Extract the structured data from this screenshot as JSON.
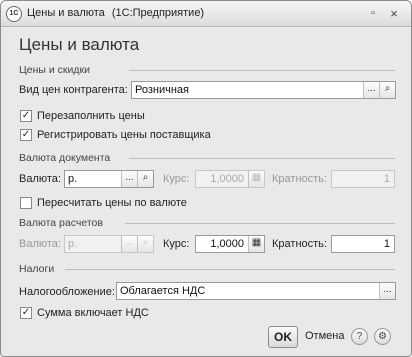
{
  "window": {
    "app_icon": "1c-logo",
    "title": "Цены и валюта",
    "app_name": "(1С:Предприятие)",
    "menu_icon": "small-menu-icon",
    "close_icon": "close-icon"
  },
  "heading": "Цены и валюта",
  "prices_group": {
    "header": "Цены и скидки",
    "price_type_label": "Вид цен контрагента:",
    "price_type_value": "Розничная",
    "refill_prices_label": "Перезаполнить цены",
    "refill_prices_checked": true,
    "register_supplier_prices_label": "Регистрировать цены поставщика",
    "register_supplier_prices_checked": true
  },
  "document_currency_group": {
    "header": "Валюта документа",
    "currency_label": "Валюта:",
    "currency_value": "р.",
    "rate_label": "Курс:",
    "rate_value": "1,0000",
    "multiplicity_label": "Кратность:",
    "multiplicity_value": "1",
    "recalc_label": "Пересчитать цены по валюте",
    "recalc_checked": false
  },
  "settlement_currency_group": {
    "header": "Валюта расчетов",
    "currency_label": "Валюта:",
    "currency_value": "р.",
    "rate_label": "Курс:",
    "rate_value": "1,0000",
    "multiplicity_label": "Кратность:",
    "multiplicity_value": "1"
  },
  "taxes_group": {
    "header": "Налоги",
    "taxation_label": "Налогообложение:",
    "taxation_value": "Облагается НДС",
    "amount_includes_vat_label": "Сумма включает НДС",
    "amount_includes_vat_checked": true
  },
  "buttons": {
    "ok": "OK",
    "cancel": "Отмена",
    "help_glyph": "?",
    "settings_glyph": "⚙"
  },
  "glyphs": {
    "select": "...",
    "search": "🔍",
    "calculator": "▦",
    "check": "✓"
  }
}
